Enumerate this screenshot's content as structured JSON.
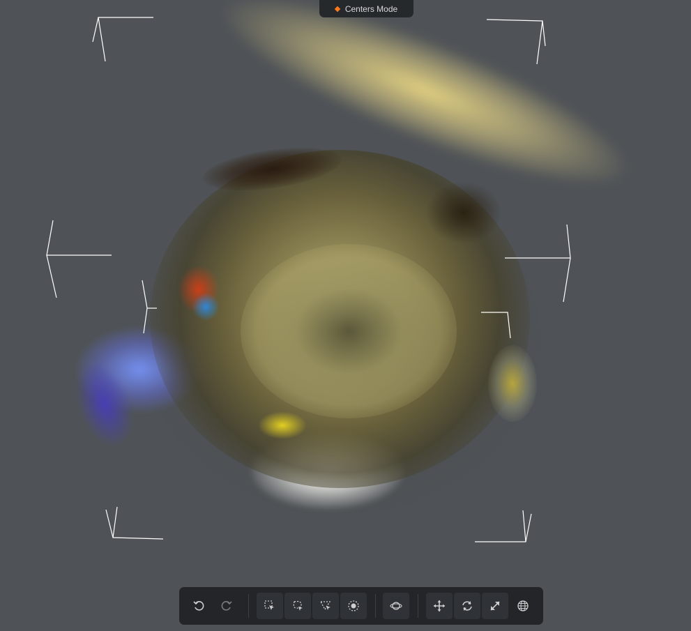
{
  "mode_badge": {
    "label": "Centers Mode",
    "icon": "diamond-icon",
    "color": "#ff7a1a"
  },
  "toolbar": {
    "groups": [
      [
        {
          "name": "undo",
          "icon": "undo-icon",
          "enabled": true
        },
        {
          "name": "redo",
          "icon": "redo-icon",
          "enabled": false
        }
      ],
      [
        {
          "name": "rect-select",
          "icon": "rect-select-icon"
        },
        {
          "name": "lasso-select",
          "icon": "lasso-select-icon"
        },
        {
          "name": "polygon-select",
          "icon": "polygon-select-icon"
        },
        {
          "name": "brush-select",
          "icon": "brush-select-icon"
        }
      ],
      [
        {
          "name": "camera-orbit",
          "icon": "orbit-icon"
        }
      ],
      [
        {
          "name": "move",
          "icon": "move-icon"
        },
        {
          "name": "rotate",
          "icon": "rotate-icon"
        },
        {
          "name": "scale",
          "icon": "scale-icon"
        },
        {
          "name": "world-space",
          "icon": "globe-icon"
        }
      ]
    ]
  },
  "colors": {
    "background": "#4f5357",
    "toolbar": "#232528",
    "accent": "#ff7a1a"
  }
}
